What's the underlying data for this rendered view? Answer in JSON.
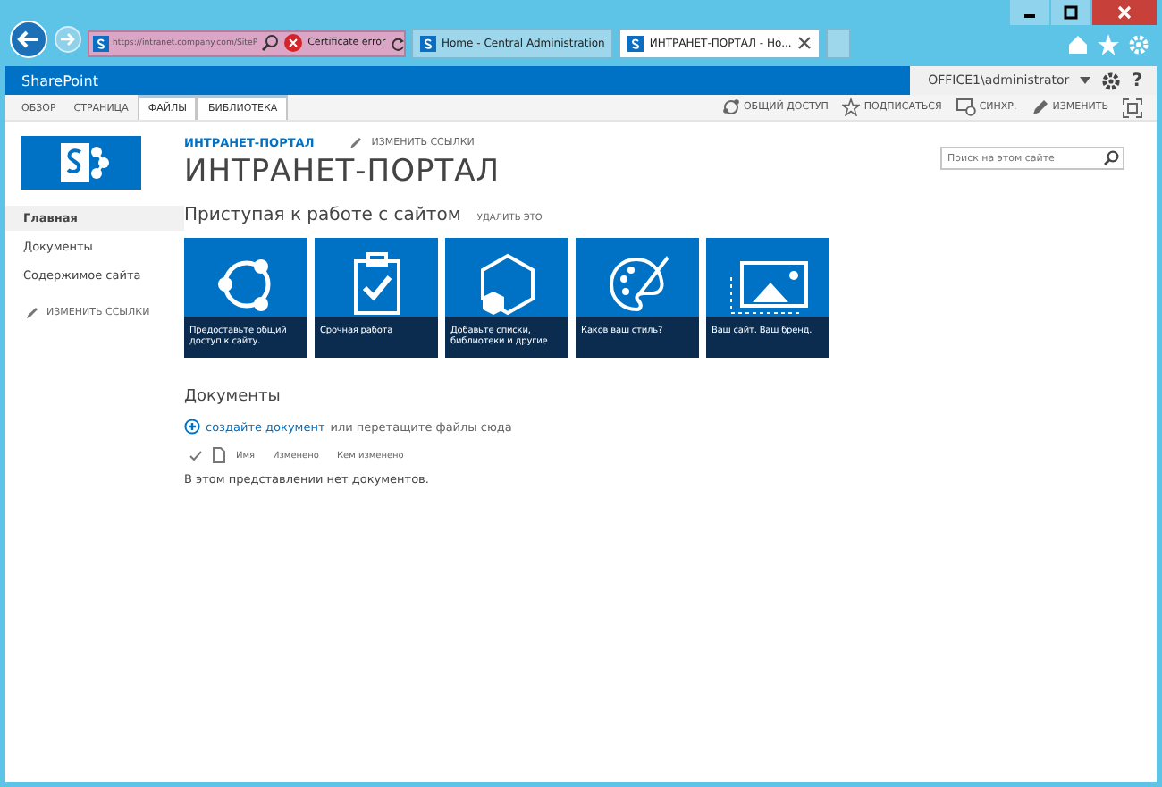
{
  "browser": {
    "url": "https://intranet.company.com/SiteP",
    "cert_error": "Certificate error",
    "tabs": [
      {
        "title": "Home - Central Administration",
        "selected": false
      },
      {
        "title": "ИНТРАНЕТ-ПОРТАЛ - Ho...",
        "selected": true
      }
    ]
  },
  "suite_bar": {
    "brand": "SharePoint",
    "user": "OFFICE1\\administrator",
    "help": "?"
  },
  "ribbon": {
    "tabs": [
      {
        "label": "ОБЗОР",
        "selected": false
      },
      {
        "label": "СТРАНИЦА",
        "selected": false
      },
      {
        "label": "ФАЙЛЫ",
        "selected": true
      },
      {
        "label": "БИБЛИОТЕКА",
        "selected": true
      }
    ],
    "actions": [
      {
        "kind": "share",
        "label": "ОБЩИЙ ДОСТУП"
      },
      {
        "kind": "follow",
        "label": "ПОДПИСАТЬСЯ"
      },
      {
        "kind": "sync",
        "label": "СИНХР."
      },
      {
        "kind": "edit",
        "label": "ИЗМЕНИТЬ"
      },
      {
        "kind": "focus"
      }
    ]
  },
  "site": {
    "breadcrumb": "ИНТРАНЕТ-ПОРТАЛ",
    "edit_links": "ИЗМЕНИТЬ ССЫЛКИ",
    "title": "ИНТРАНЕТ-ПОРТАЛ",
    "search": {
      "placeholder": "Поиск на этом сайте"
    }
  },
  "nav": {
    "items": [
      {
        "label": "Главная",
        "selected": true
      },
      {
        "label": "Документы",
        "selected": false
      },
      {
        "label": "Содержимое сайта",
        "selected": false
      }
    ],
    "edit_links": "ИЗМЕНИТЬ ССЫЛКИ"
  },
  "getting_started": {
    "heading": "Приступая к работе с сайтом",
    "dismiss": "УДАЛИТЬ ЭТО",
    "tiles": [
      {
        "kind": "share",
        "label": "Предоставьте общий доступ к сайту."
      },
      {
        "kind": "task",
        "label": "Срочная работа"
      },
      {
        "kind": "apps",
        "label": "Добавьте списки, библиотеки и другие"
      },
      {
        "kind": "style",
        "label": "Каков ваш стиль?"
      },
      {
        "kind": "brand",
        "label": "Ваш сайт. Ваш бренд."
      }
    ]
  },
  "documents": {
    "heading": "Документы",
    "new_link": "создайте документ",
    "hint": "или перетащите файлы сюда",
    "columns": [
      "Имя",
      "Изменено",
      "Кем изменено"
    ],
    "empty": "В этом представлении нет документов."
  }
}
